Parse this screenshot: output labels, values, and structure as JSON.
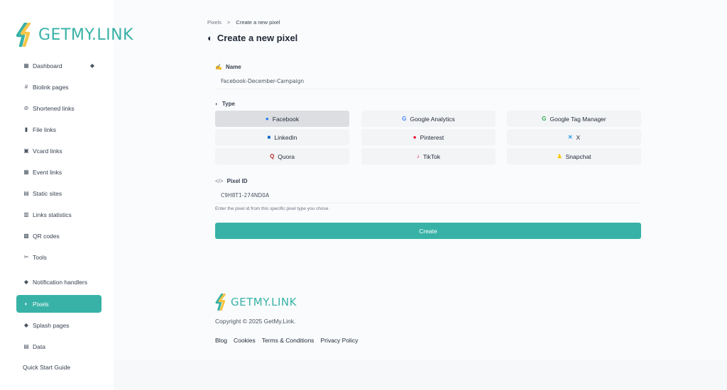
{
  "brand": {
    "name": "GETMY.LINK",
    "accent": "#38b2a7",
    "logo_yellow": "#f6c342"
  },
  "sidebar": {
    "items": [
      {
        "label": "Dashboard",
        "icon": "grid-icon",
        "glyph": "▦",
        "has_bell": true
      },
      {
        "label": "Biolink pages",
        "icon": "hash-icon",
        "glyph": "#"
      },
      {
        "label": "Shortened links",
        "icon": "link-icon",
        "glyph": "⊘"
      },
      {
        "label": "File links",
        "icon": "file-icon",
        "glyph": "▮"
      },
      {
        "label": "Vcard links",
        "icon": "id-card-icon",
        "glyph": "▣"
      },
      {
        "label": "Event links",
        "icon": "calendar-icon",
        "glyph": "▦"
      },
      {
        "label": "Static sites",
        "icon": "document-icon",
        "glyph": "▤"
      },
      {
        "label": "Links statistics",
        "icon": "chart-icon",
        "glyph": "▥"
      },
      {
        "label": "QR codes",
        "icon": "qr-code-icon",
        "glyph": "▩"
      },
      {
        "label": "Tools",
        "icon": "tools-icon",
        "glyph": "✂"
      },
      {
        "label": "Notification handlers",
        "icon": "bell-icon",
        "glyph": "◆"
      },
      {
        "label": "Pixels",
        "icon": "adjust-icon",
        "glyph": "◐",
        "active": true
      },
      {
        "label": "Splash pages",
        "icon": "droplet-icon",
        "glyph": "◆"
      },
      {
        "label": "Data",
        "icon": "database-icon",
        "glyph": "▤"
      }
    ],
    "quick_start": "Quick Start Guide"
  },
  "breadcrumb": {
    "parent": "Pixels",
    "separator": ">",
    "current": "Create a new pixel"
  },
  "page": {
    "title": "Create a new pixel",
    "title_icon": "adjust-icon"
  },
  "form": {
    "name_label": "Name",
    "name_value": "Facebook-December-Campaign",
    "type_label": "Type",
    "types": [
      {
        "label": "Facebook",
        "icon": "facebook-icon",
        "glyph": "●",
        "color": "#1877f2",
        "selected": true
      },
      {
        "label": "Google Analytics",
        "icon": "google-icon",
        "glyph": "G",
        "color": "#4285f4"
      },
      {
        "label": "Google Tag Manager",
        "icon": "google-icon",
        "glyph": "G",
        "color": "#34a853"
      },
      {
        "label": "LinkedIn",
        "icon": "linkedin-icon",
        "glyph": "■",
        "color": "#0a66c2"
      },
      {
        "label": "Pinterest",
        "icon": "pinterest-icon",
        "glyph": "●",
        "color": "#e60023"
      },
      {
        "label": "X",
        "icon": "x-icon",
        "glyph": "✕",
        "color": "#1d9bf0"
      },
      {
        "label": "Quora",
        "icon": "quora-icon",
        "glyph": "Q",
        "color": "#b92b27"
      },
      {
        "label": "TikTok",
        "icon": "tiktok-icon",
        "glyph": "♪",
        "color": "#ee1d52"
      },
      {
        "label": "Snapchat",
        "icon": "snapchat-icon",
        "glyph": "♟",
        "color": "#f7c600"
      }
    ],
    "pixel_id_label": "Pixel ID",
    "pixel_id_value": "C9H8T1-274ND0A",
    "pixel_id_hint": "Enter the pixel id from this specific pixel type you chose.",
    "submit_label": "Create"
  },
  "footer": {
    "copyright": "Copyright © 2025 GetMy.Link.",
    "links": [
      "Blog",
      "Cookies",
      "Terms & Conditions",
      "Privacy Policy"
    ]
  }
}
